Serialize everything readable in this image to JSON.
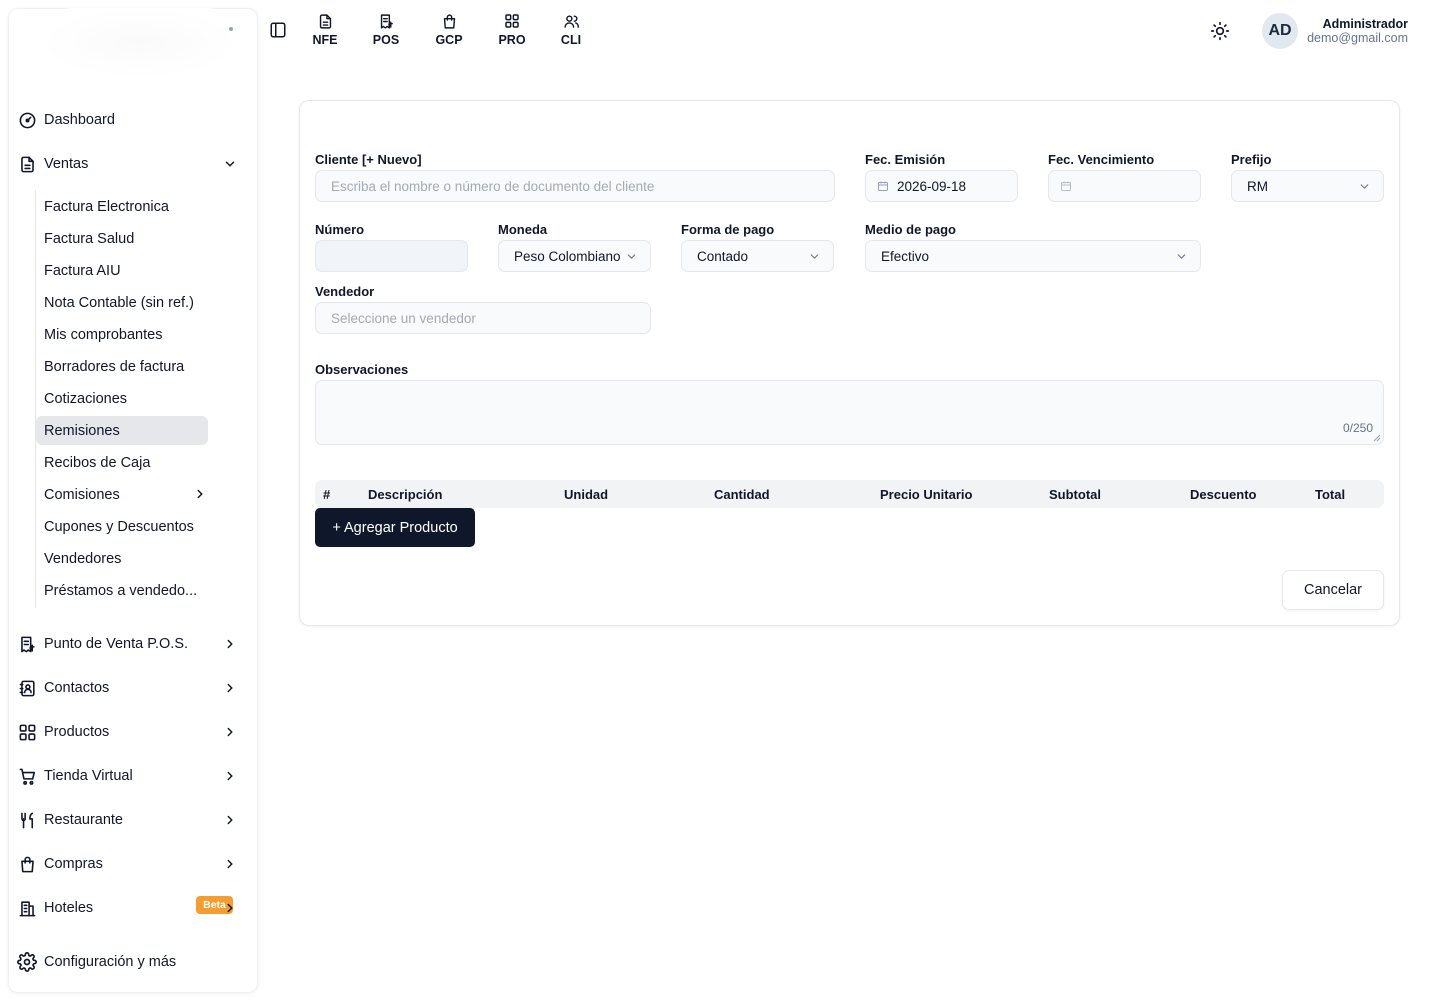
{
  "topbar": {
    "modules": [
      {
        "label": "NFE",
        "icon": "file-text-icon"
      },
      {
        "label": "POS",
        "icon": "receipt-icon"
      },
      {
        "label": "GCP",
        "icon": "shopping-bag-icon"
      },
      {
        "label": "PRO",
        "icon": "grid-icon"
      },
      {
        "label": "CLI",
        "icon": "users-icon"
      }
    ],
    "user": {
      "initials": "AD",
      "name": "Administrador",
      "email": "demo@gmail.com"
    }
  },
  "sidebar": {
    "dashboard": "Dashboard",
    "ventas": "Ventas",
    "ventas_items": [
      "Factura Electronica",
      "Factura Salud",
      "Factura AIU",
      "Nota Contable (sin ref.)",
      "Mis comprobantes",
      "Borradores de factura",
      "Cotizaciones",
      "Remisiones",
      "Recibos de Caja",
      "Comisiones",
      "Cupones y Descuentos",
      "Vendedores",
      "Préstamos a vendedo..."
    ],
    "active_item": "Remisiones",
    "sections": [
      {
        "label": "Punto de Venta P.O.S.",
        "icon": "pos-icon"
      },
      {
        "label": "Contactos",
        "icon": "contacts-icon"
      },
      {
        "label": "Productos",
        "icon": "grid-icon"
      },
      {
        "label": "Tienda Virtual",
        "icon": "cart-icon"
      },
      {
        "label": "Restaurante",
        "icon": "utensils-icon"
      },
      {
        "label": "Compras",
        "icon": "shopping-bag-icon"
      },
      {
        "label": "Hoteles",
        "icon": "hotel-icon",
        "badge": "Beta"
      }
    ],
    "settings": "Configuración y más"
  },
  "form": {
    "cliente_label": "Cliente [+ Nuevo]",
    "cliente_placeholder": "Escriba el nombre o número de documento del cliente",
    "fec_emision_label": "Fec. Emisión",
    "fec_emision_value": "2026-09-18",
    "fec_vencimiento_label": "Fec. Vencimiento",
    "fec_vencimiento_value": "",
    "prefijo_label": "Prefijo",
    "prefijo_value": "RM",
    "numero_label": "Número",
    "numero_value": "",
    "moneda_label": "Moneda",
    "moneda_value": "Peso Colombiano",
    "forma_pago_label": "Forma de pago",
    "forma_pago_value": "Contado",
    "medio_pago_label": "Medio de pago",
    "medio_pago_value": "Efectivo",
    "vendedor_label": "Vendedor",
    "vendedor_placeholder": "Seleccione un vendedor",
    "observaciones_label": "Observaciones",
    "observaciones_counter": "0/250"
  },
  "table": {
    "columns": [
      "#",
      "Descripción",
      "Unidad",
      "Cantidad",
      "Precio Unitario",
      "Subtotal",
      "Descuento",
      "Total"
    ],
    "rows": []
  },
  "actions": {
    "add_product": "+ Agregar Producto",
    "cancel": "Cancelar"
  },
  "colors": {
    "primary": "#0f172a",
    "badge": "#f59e2f",
    "active_bg": "#e5e7eb",
    "field_bg": "#f8fafc"
  }
}
